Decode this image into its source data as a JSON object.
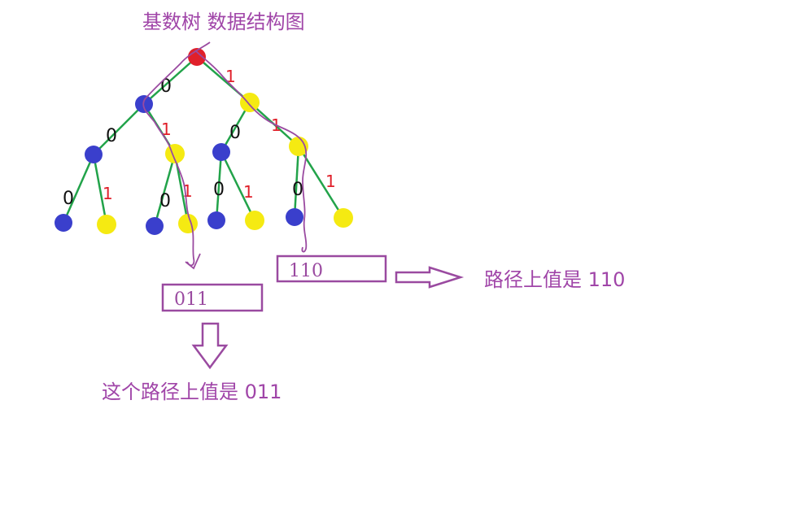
{
  "title": "基数树  数据结构图",
  "colors": {
    "accent": "#a045a8",
    "edge": "#22a34a",
    "root": "#e0202a",
    "zero_node": "#3a3fcc",
    "one_node": "#f5ea12",
    "label_zero": "#111111",
    "label_one": "#e0202a",
    "path": "#9a4aa0"
  },
  "tree": {
    "edge_labels": {
      "root_l": "0",
      "root_r": "1",
      "a_l": "0",
      "a_r": "1",
      "b_l": "0",
      "b_r": "1",
      "c_l": "0",
      "c_r": "1",
      "d_l": "0",
      "d_r": "1",
      "e_l": "0",
      "e_r": "1",
      "f_l": "0",
      "f_r": "1"
    }
  },
  "boxes": {
    "path_011": "011",
    "path_110": "110"
  },
  "captions": {
    "left": "这个路径上值是  011",
    "right": "路径上值是  110"
  }
}
